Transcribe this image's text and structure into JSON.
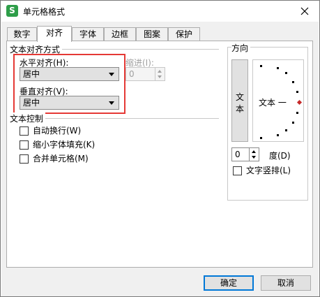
{
  "window": {
    "title": "单元格格式",
    "app_icon_letter": "S",
    "accent_color": "#2e9e49"
  },
  "tabs": [
    {
      "label": "数字",
      "active": false
    },
    {
      "label": "对齐",
      "active": true
    },
    {
      "label": "字体",
      "active": false
    },
    {
      "label": "边框",
      "active": false
    },
    {
      "label": "图案",
      "active": false
    },
    {
      "label": "保护",
      "active": false
    }
  ],
  "alignment": {
    "group_label": "文本对齐方式",
    "horizontal_label": "水平对齐(H):",
    "horizontal_value": "居中",
    "vertical_label": "垂直对齐(V):",
    "vertical_value": "居中",
    "indent_label": "缩进(I):",
    "indent_value": "0",
    "highlight_color": "#e53935"
  },
  "text_control": {
    "group_label": "文本控制",
    "options": [
      {
        "label": "自动换行(W)",
        "checked": false
      },
      {
        "label": "缩小字体填充(K)",
        "checked": false
      },
      {
        "label": "合并单元格(M)",
        "checked": false
      }
    ]
  },
  "orientation": {
    "group_label": "方向",
    "vertical_text_button": "文本",
    "dial_text": "文本 一",
    "degree_value": "0",
    "degree_label": "度(D)",
    "vertical_layout_label": "文字竖排(L)"
  },
  "buttons": {
    "ok": "确定",
    "cancel": "取消"
  }
}
